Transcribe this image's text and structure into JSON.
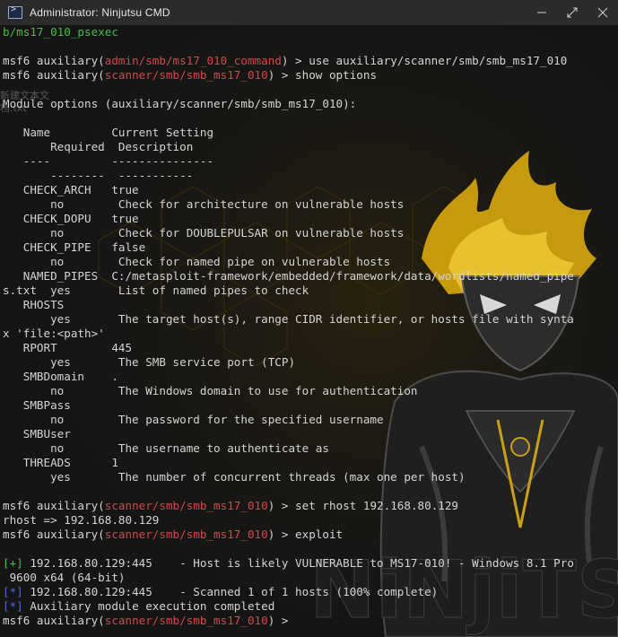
{
  "window": {
    "title": "Administrator:  Ninjutsu CMD",
    "minimize_icon": "minimize-icon",
    "restore_icon": "restore-icon",
    "close_icon": "close-icon"
  },
  "background": {
    "watermark_text": "NiNjiTS",
    "desktop_ghost_lines": [
      "新建文本文",
      "档.txt"
    ]
  },
  "terminal": {
    "line_00": "b/ms17_010_psexec",
    "line_02a": "msf6 auxiliary(",
    "line_02b": "admin/smb/ms17_010_command",
    "line_02c": ") > use auxiliary/scanner/smb/smb_ms17_010",
    "line_03a": "msf6 auxiliary(",
    "line_03b": "scanner/smb/smb_ms17_010",
    "line_03c": ") > show options",
    "line_05": "Module options (auxiliary/scanner/smb/smb_ms17_010):",
    "line_07": "   Name         Current Setting",
    "line_08": "       Required  Description",
    "line_09": "   ----         ---------------",
    "line_10": "       --------  -----------",
    "line_11": "   CHECK_ARCH   true",
    "line_12": "       no        Check for architecture on vulnerable hosts",
    "line_13": "   CHECK_DOPU   true",
    "line_14": "       no        Check for DOUBLEPULSAR on vulnerable hosts",
    "line_15": "   CHECK_PIPE   false",
    "line_16": "       no        Check for named pipe on vulnerable hosts",
    "line_17": "   NAMED_PIPES  C:/metasploit-framework/embedded/framework/data/wordlists/named_pipe",
    "line_18": "s.txt  yes       List of named pipes to check",
    "line_19": "   RHOSTS",
    "line_20": "       yes       The target host(s), range CIDR identifier, or hosts file with synta",
    "line_21": "x 'file:<path>'",
    "line_22": "   RPORT        445",
    "line_23": "       yes       The SMB service port (TCP)",
    "line_24": "   SMBDomain    .",
    "line_25": "       no        The Windows domain to use for authentication",
    "line_26": "   SMBPass",
    "line_27": "       no        The password for the specified username",
    "line_28": "   SMBUser",
    "line_29": "       no        The username to authenticate as",
    "line_30": "   THREADS      1",
    "line_31": "       yes       The number of concurrent threads (max one per host)",
    "line_33a": "msf6 auxiliary(",
    "line_33b": "scanner/smb/smb_ms17_010",
    "line_33c": ") > set rhost 192.168.80.129",
    "line_34": "rhost => 192.168.80.129",
    "line_35a": "msf6 auxiliary(",
    "line_35b": "scanner/smb/smb_ms17_010",
    "line_35c": ") > exploit",
    "line_37a": "[+]",
    "line_37b": " 192.168.80.129:445    - Host is likely VULNERABLE to MS17-010! - Windows 8.1 Pro",
    "line_38": " 9600 x64 (64-bit)",
    "line_39a": "[*]",
    "line_39b": " 192.168.80.129:445    - Scanned 1 of 1 hosts (100% complete)",
    "line_40a": "[*]",
    "line_40b": " Auxiliary module execution completed",
    "line_41a": "msf6 auxiliary(",
    "line_41b": "scanner/smb/smb_ms17_010",
    "line_41c": ") > "
  },
  "colors": {
    "background": "#151515",
    "text": "#d4d4d4",
    "module_path": "#d24a4a",
    "success_marker": "#3fbf3f",
    "info_marker": "#4b6fd6",
    "accent_yellow": "#e8c21a"
  }
}
